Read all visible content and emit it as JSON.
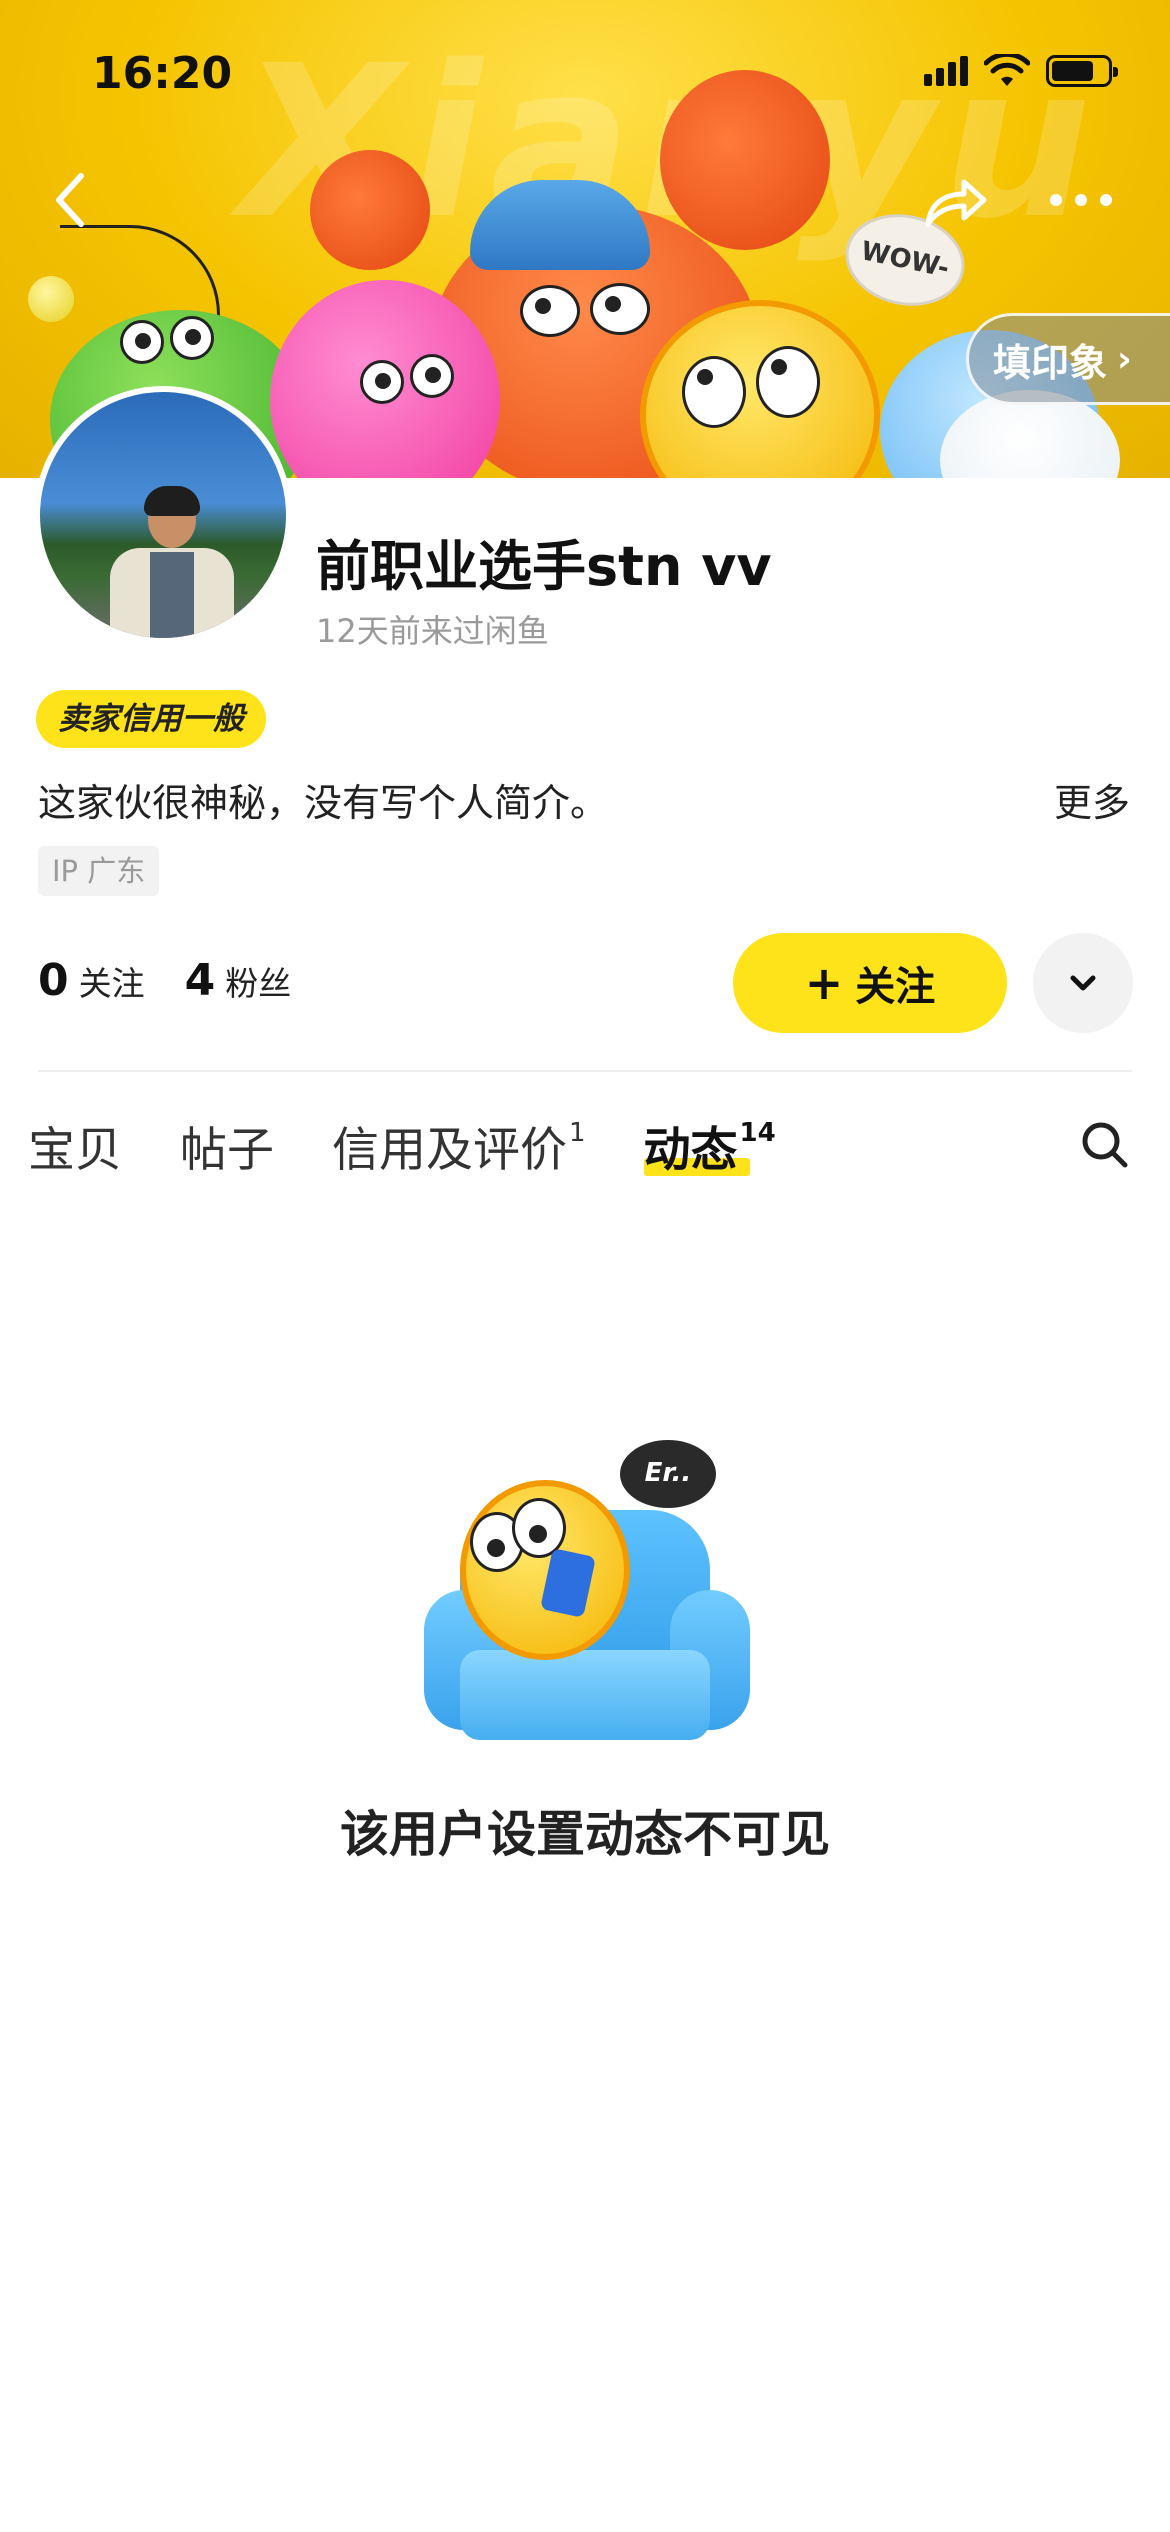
{
  "status_bar": {
    "time": "16:20",
    "battery_level": 0.75
  },
  "banner": {
    "watermark": "Xianyu",
    "wow_label": "WOW-",
    "impression_button": "填印象",
    "impression_chevron": "›"
  },
  "icons": {
    "back": "chevron-left-icon",
    "share": "share-arrow-icon",
    "more": "more-dots-icon",
    "dropdown": "chevron-down-icon",
    "search": "search-icon"
  },
  "profile": {
    "username": "前职业选手stn vv",
    "last_seen": "12天前来过闲鱼",
    "credit_badge": "卖家信用一般",
    "bio": "这家伙很神秘，没有写个人简介。",
    "more_link": "更多",
    "ip_location": "IP 广东",
    "following_count": "0",
    "following_label": "关注",
    "followers_count": "4",
    "followers_label": "粉丝",
    "follow_button_icon": "+",
    "follow_button": "关注"
  },
  "tabs": [
    {
      "label": "宝贝",
      "badge": ""
    },
    {
      "label": "帖子",
      "badge": ""
    },
    {
      "label": "信用及评价",
      "badge": "1"
    },
    {
      "label": "动态",
      "badge": "14",
      "active": true
    }
  ],
  "empty_state": {
    "bubble": "Er..",
    "message": "该用户设置动态不可见"
  },
  "colors": {
    "accent_yellow": "#ffe31a",
    "banner_yellow": "#f5c400",
    "text_primary": "#111111",
    "text_secondary": "#9a9a9a"
  }
}
